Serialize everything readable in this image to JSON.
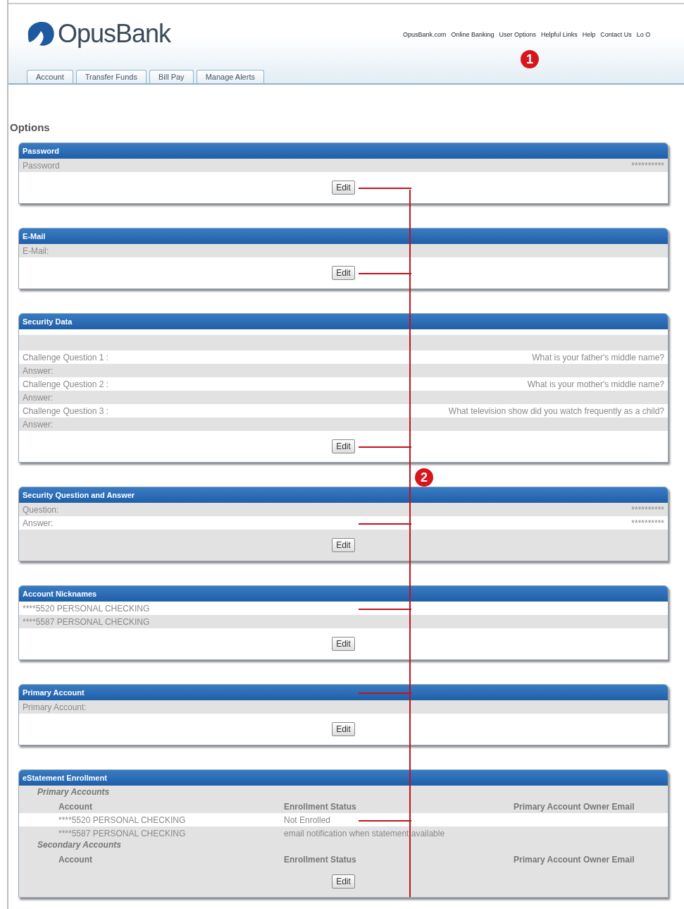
{
  "logo": {
    "name": "OpusBank"
  },
  "nav_links": [
    "OpusBank.com",
    "Online Banking",
    "User Options",
    "Helpful Links",
    "Help",
    "Contact Us",
    "Lo O"
  ],
  "tabs": [
    "Account",
    "Transfer Funds",
    "Bill Pay",
    "Manage Alerts"
  ],
  "page_title": "Options",
  "sections": [
    {
      "kind": "plain",
      "title": "Password",
      "rows": [
        {
          "label": "Password",
          "value": "**********",
          "shaded": true,
          "pointer": false
        }
      ],
      "button": "Edit",
      "edit_shaded": false,
      "edit_pointer": true,
      "header_pointer": false
    },
    {
      "kind": "plain",
      "title": "E-Mail",
      "rows": [
        {
          "label": "E-Mail:",
          "shaded": true,
          "pointer": false
        }
      ],
      "button": "Edit",
      "edit_shaded": false,
      "edit_pointer": true,
      "header_pointer": false
    },
    {
      "kind": "questions",
      "title": "Security Data",
      "rows": [
        {
          "label": "Challenge Question 1 :",
          "value": "What is your father's middle name?",
          "shaded": false,
          "pointer": false
        },
        {
          "label": "Answer:",
          "shaded": true,
          "pointer": false
        },
        {
          "label": "Challenge Question 2 :",
          "value": "What is your mother's middle name?",
          "shaded": false,
          "pointer": false
        },
        {
          "label": "Answer:",
          "shaded": true,
          "pointer": false
        },
        {
          "label": "Challenge Question 3 :",
          "value": "What television show did you watch frequently as a child?",
          "shaded": false,
          "pointer": false
        },
        {
          "label": "Answer:",
          "shaded": true,
          "pointer": false
        }
      ],
      "button": "Edit",
      "edit_shaded": false,
      "edit_pointer": true,
      "header_pointer": false
    },
    {
      "kind": "plain",
      "title": "Security Question and Answer",
      "rows": [
        {
          "label": "Question:",
          "value": "**********",
          "shaded": true,
          "pointer": false
        },
        {
          "label": "Answer:",
          "value": "**********",
          "shaded": false,
          "pointer": true
        }
      ],
      "button": "Edit",
      "edit_shaded": true,
      "edit_pointer": false,
      "header_pointer": false
    },
    {
      "kind": "plain",
      "title": "Account Nicknames",
      "rows": [
        {
          "label": "****5520 PERSONAL CHECKING",
          "shaded": false,
          "pointer": true
        },
        {
          "label": "****5587 PERSONAL CHECKING",
          "shaded": true,
          "pointer": false
        }
      ],
      "button": "Edit",
      "edit_shaded": false,
      "edit_pointer": false,
      "header_pointer": false
    },
    {
      "kind": "plain",
      "title": "Primary Account",
      "rows": [
        {
          "label": "Primary Account:",
          "shaded": true,
          "pointer": false
        }
      ],
      "button": "Edit",
      "edit_shaded": false,
      "edit_pointer": false,
      "header_pointer": true
    },
    {
      "kind": "table",
      "title": "eStatement Enrollment",
      "groups": [
        {
          "title": "Primary Accounts",
          "columns": [
            "Account",
            "Enrollment Status",
            "Primary Account Owner Email"
          ],
          "rows": [
            {
              "cells": [
                "****5520 PERSONAL CHECKING",
                "Not Enrolled"
              ],
              "shaded": false,
              "pointer": true
            },
            {
              "cells": [
                "****5587 PERSONAL CHECKING",
                "email notification when statement available"
              ],
              "shaded": true,
              "pointer": false
            }
          ]
        },
        {
          "title": "Secondary Accounts",
          "columns": [
            "Account",
            "Enrollment Status",
            "Primary Account Owner Email"
          ]
        }
      ],
      "button": "Edit",
      "edit_shaded": true,
      "edit_pointer": false,
      "header_pointer": false
    }
  ],
  "callouts": [
    "1",
    "2"
  ]
}
